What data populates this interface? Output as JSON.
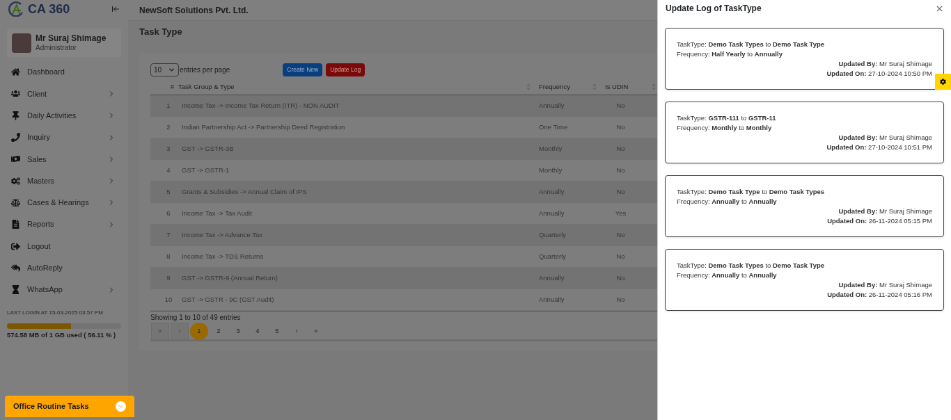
{
  "brand": {
    "name": "CA 360"
  },
  "user": {
    "name": "Mr Suraj Shimage",
    "role": "Administrator"
  },
  "nav": [
    {
      "label": "Dashboard",
      "submenu": false
    },
    {
      "label": "Client",
      "submenu": true
    },
    {
      "label": "Daily Activities",
      "submenu": true
    },
    {
      "label": "Inquiry",
      "submenu": true
    },
    {
      "label": "Sales",
      "submenu": true
    },
    {
      "label": "Masters",
      "submenu": true
    },
    {
      "label": "Cases & Hearings",
      "submenu": true
    },
    {
      "label": "Reports",
      "submenu": true
    },
    {
      "label": "Logout",
      "submenu": false
    },
    {
      "label": "AutoReply",
      "submenu": false
    },
    {
      "label": "WhatsApp",
      "submenu": true
    }
  ],
  "last_login": "LAST LOGIN AT 15-03-2025 03:57 PM",
  "storage": {
    "level": 0.5611,
    "text": "574.58 MB of 1 GB used ( 56.11 % )"
  },
  "routine": {
    "label": "Office Routine Tasks"
  },
  "company": "NewSoft Solutions Pvt. Ltd.",
  "page_title": "Task Type",
  "page_size": {
    "value": "10",
    "label": "entries per page"
  },
  "buttons": [
    {
      "label": "Create New",
      "kind": "primary"
    },
    {
      "label": "Update Log",
      "kind": "danger"
    }
  ],
  "table": {
    "columns": [
      "#",
      "Task Group & Type",
      "Frequency",
      "Is UDIN"
    ],
    "rows": [
      [
        "1",
        "Income Tax -> Income Tax Return (ITR) - NON AUDIT",
        "Annually",
        "No"
      ],
      [
        "2",
        "Indian Partnership Act -> Partnership Deed Registration",
        "One Time",
        "No"
      ],
      [
        "3",
        "GST -> GSTR-3B",
        "Monthly",
        "No"
      ],
      [
        "4",
        "GST -> GSTR-1",
        "Monthly",
        "No"
      ],
      [
        "5",
        "Grants & Subsidies -> Annual Claim of IPS",
        "Annually",
        "No"
      ],
      [
        "6",
        "Income Tax -> Tax Audit",
        "Annually",
        "Yes"
      ],
      [
        "7",
        "Income Tax -> Advance Tax",
        "Quarterly",
        "No"
      ],
      [
        "8",
        "Income Tax -> TDS Returns",
        "Quarterly",
        "No"
      ],
      [
        "9",
        "GST -> GSTR-9 (Annual Return)",
        "Annually",
        "No"
      ],
      [
        "10",
        "GST -> GSTR - 9C (GST Audit)",
        "Annually",
        "No"
      ]
    ]
  },
  "table_info": "Showing 1 to 10 of 49 entries",
  "pagination": [
    {
      "label": "«",
      "selected": false,
      "disabled": true
    },
    {
      "label": "‹",
      "selected": false,
      "disabled": true
    },
    {
      "label": "1",
      "selected": true,
      "disabled": false
    },
    {
      "label": "2",
      "selected": false,
      "disabled": false
    },
    {
      "label": "3",
      "selected": false,
      "disabled": false
    },
    {
      "label": "4",
      "selected": false,
      "disabled": false
    },
    {
      "label": "5",
      "selected": false,
      "disabled": false
    },
    {
      "label": "›",
      "selected": false,
      "disabled": false
    },
    {
      "label": "»",
      "selected": false,
      "disabled": false
    }
  ],
  "drawer": {
    "title": "Update Log of TaskType",
    "entries": [
      {
        "task_type": "TaskType: **Demo Task Types** to **Demo Task Type**",
        "frequency": "Frequency: **Half Yearly** to **Annually**",
        "updated_by": "**Updated By:** Mr Suraj Shimage",
        "updated_on": "**Updated On:** 27-10-2024 10:50 PM"
      },
      {
        "task_type": "TaskType: **GSTR-111** to **GSTR-11**",
        "frequency": "Frequency: **Monthly** to **Monthly**",
        "updated_by": "**Updated By:** Mr Suraj Shimage",
        "updated_on": "**Updated On:** 27-10-2024 10:51 PM"
      },
      {
        "task_type": "TaskType: **Demo Task Type** to **Demo Task Types**",
        "frequency": "Frequency: **Annually** to **Annually**",
        "updated_by": "**Updated By:** Mr Suraj Shimage",
        "updated_on": "**Updated On:** 26-11-2024 05:15 PM"
      },
      {
        "task_type": "TaskType: **Demo Task Types** to **Demo Task Type**",
        "frequency": "Frequency: **Annually** to **Annually**",
        "updated_by": "**Updated By:** Mr Suraj Shimage",
        "updated_on": "**Updated On:** 26-11-2024 05:16 PM"
      }
    ]
  }
}
